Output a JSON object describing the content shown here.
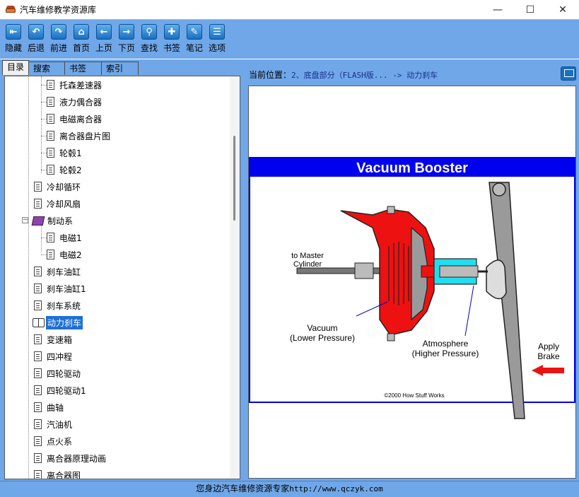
{
  "window": {
    "title": "汽车维修教学资源库",
    "minimize": "—",
    "maximize": "☐",
    "close": "✕"
  },
  "toolbar": [
    {
      "label": "隐藏",
      "icon": "hide-icon",
      "glyph": "⇤"
    },
    {
      "label": "后退",
      "icon": "back-icon",
      "glyph": "↶"
    },
    {
      "label": "前进",
      "icon": "forward-icon",
      "glyph": "↷"
    },
    {
      "label": "首页",
      "icon": "home-icon",
      "glyph": "⌂"
    },
    {
      "label": "上页",
      "icon": "prev-page-icon",
      "glyph": "←"
    },
    {
      "label": "下页",
      "icon": "next-page-icon",
      "glyph": "→"
    },
    {
      "label": "查找",
      "icon": "search-icon",
      "glyph": "⚲"
    },
    {
      "label": "书签",
      "icon": "bookmark-icon",
      "glyph": "✚"
    },
    {
      "label": "笔记",
      "icon": "note-icon",
      "glyph": "✎"
    },
    {
      "label": "选项",
      "icon": "options-icon",
      "glyph": "☰"
    }
  ],
  "tabs": [
    {
      "label": "目录",
      "active": true
    },
    {
      "label": "搜索",
      "active": false
    },
    {
      "label": "书签",
      "active": false
    },
    {
      "label": "索引",
      "active": false
    }
  ],
  "tree": [
    {
      "label": "托森差速器",
      "level": 2,
      "icon": "document"
    },
    {
      "label": "液力偶合器",
      "level": 2,
      "icon": "document"
    },
    {
      "label": "电磁离合器",
      "level": 2,
      "icon": "document"
    },
    {
      "label": "离合器盘片图",
      "level": 2,
      "icon": "document"
    },
    {
      "label": "轮毂1",
      "level": 2,
      "icon": "document"
    },
    {
      "label": "轮毂2",
      "level": 2,
      "icon": "document"
    },
    {
      "label": "冷却循环",
      "level": 1,
      "icon": "document"
    },
    {
      "label": "冷却风扇",
      "level": 1,
      "icon": "document"
    },
    {
      "label": "制动系",
      "level": 1,
      "icon": "book",
      "expanded": true
    },
    {
      "label": "电磁1",
      "level": 2,
      "icon": "document"
    },
    {
      "label": "电磁2",
      "level": 2,
      "icon": "document"
    },
    {
      "label": "刹车油缸",
      "level": 1,
      "icon": "document"
    },
    {
      "label": "刹车油缸1",
      "level": 1,
      "icon": "document"
    },
    {
      "label": "刹车系统",
      "level": 1,
      "icon": "document"
    },
    {
      "label": "动力刹车",
      "level": 1,
      "icon": "open-book",
      "selected": true
    },
    {
      "label": "变速箱",
      "level": 1,
      "icon": "document"
    },
    {
      "label": "四冲程",
      "level": 1,
      "icon": "document"
    },
    {
      "label": "四轮驱动",
      "level": 1,
      "icon": "document"
    },
    {
      "label": "四轮驱动1",
      "level": 1,
      "icon": "document"
    },
    {
      "label": "曲轴",
      "level": 1,
      "icon": "document"
    },
    {
      "label": "汽油机",
      "level": 1,
      "icon": "document"
    },
    {
      "label": "点火系",
      "level": 1,
      "icon": "document"
    },
    {
      "label": "离合器原理动画",
      "level": 1,
      "icon": "document"
    },
    {
      "label": "离合器图",
      "level": 1,
      "icon": "document"
    }
  ],
  "location": {
    "label": "当前位置：",
    "path": "2、底盘部分（FLASH版... -> 动力刹车"
  },
  "diagram": {
    "title": "Vacuum Booster",
    "to_master_line1": "to Master",
    "to_master_line2": "Cylinder",
    "vacuum_line1": "Vacuum",
    "vacuum_line2": "(Lower Pressure)",
    "atmos_line1": "Atmosphere",
    "atmos_line2": "(Higher Pressure)",
    "apply_line1": "Apply",
    "apply_line2": "Brake",
    "copyright": "©2000 How Stuff Works",
    "colors": {
      "banner": "#0000ee",
      "booster": "#ee1111",
      "air": "#22ddee",
      "arrow": "#ee1111"
    }
  },
  "status": {
    "text": "您身边汽车维修资源专家",
    "url": "http://www.qczyk.com"
  }
}
